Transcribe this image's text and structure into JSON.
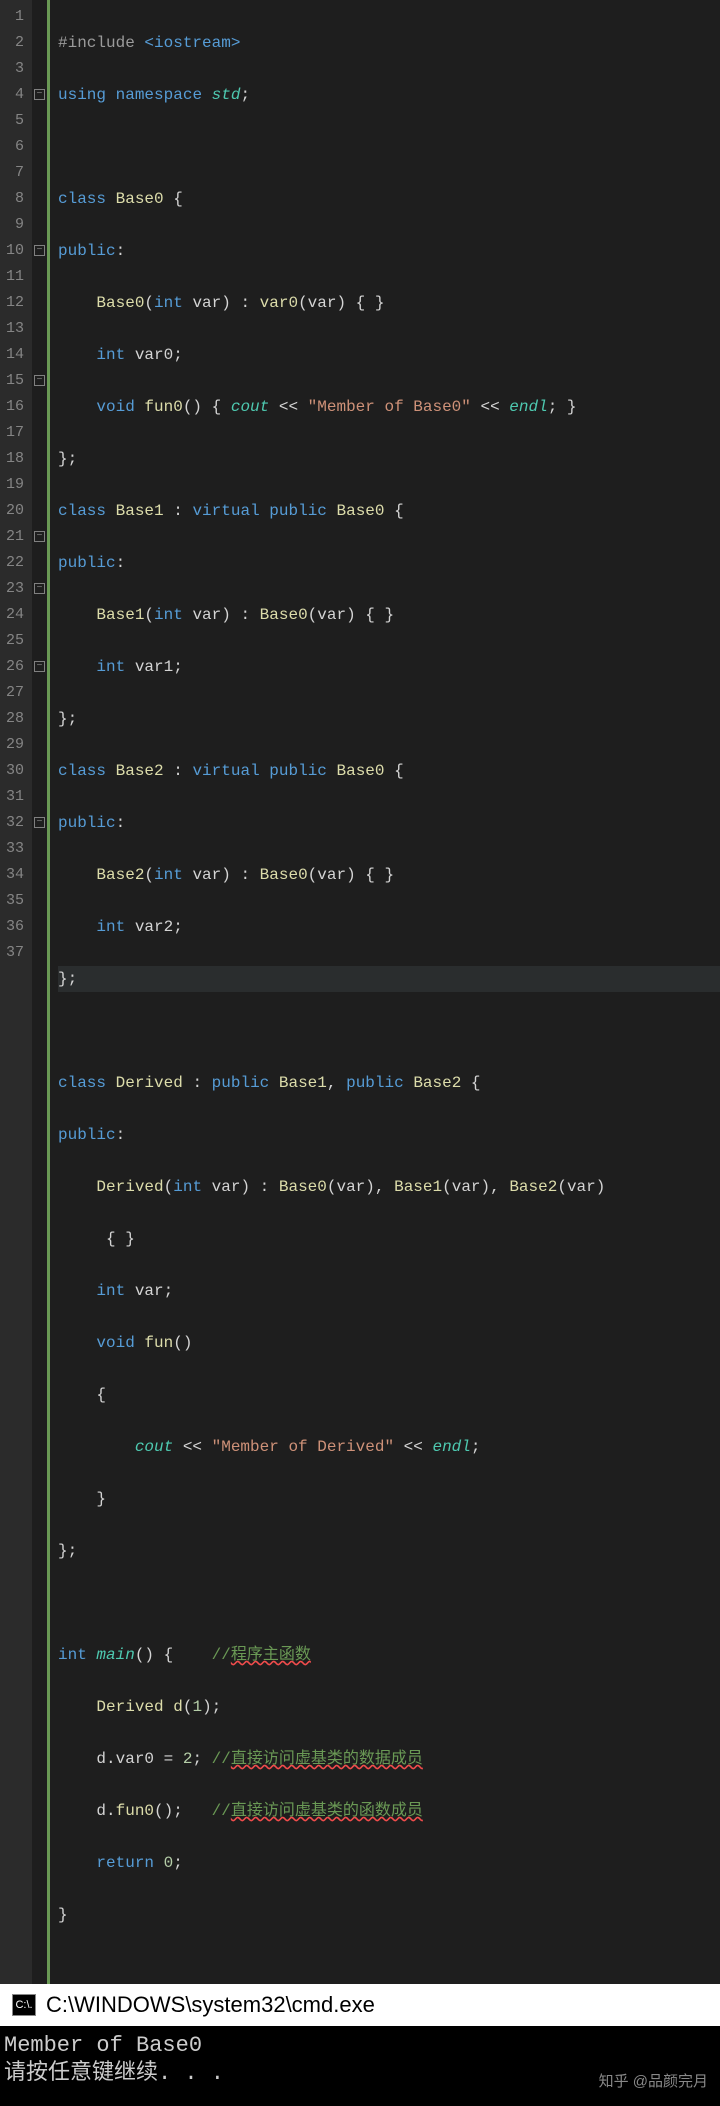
{
  "lines": {
    "count": 37
  },
  "fold_positions": [
    4,
    10,
    15,
    21,
    23,
    26,
    32
  ],
  "code": {
    "l1": {
      "a": "#include",
      "b": "<iostream>"
    },
    "l2": {
      "a": "using",
      "b": "namespace",
      "c": "std",
      "d": ";"
    },
    "l4": {
      "a": "class",
      "b": "Base0",
      "c": " {"
    },
    "l5": {
      "a": "public",
      "b": ":"
    },
    "l6": {
      "a": "Base0",
      "b": "(",
      "c": "int",
      "d": " var) : ",
      "e": "var0",
      "f": "(var) { }"
    },
    "l7": {
      "a": "int",
      "b": " var0;"
    },
    "l8": {
      "a": "void",
      "b": " ",
      "c": "fun0",
      "d": "() { ",
      "e": "cout",
      "f": " << ",
      "g": "\"Member of Base0\"",
      "h": " << ",
      "i": "endl",
      "j": "; }"
    },
    "l9": {
      "a": "};"
    },
    "l10": {
      "a": "class",
      "b": "Base1",
      "c": " : ",
      "d": "virtual",
      "e": " ",
      "f": "public",
      "g": " ",
      "h": "Base0",
      "i": " {"
    },
    "l11": {
      "a": "public",
      "b": ":"
    },
    "l12": {
      "a": "Base1",
      "b": "(",
      "c": "int",
      "d": " var) : ",
      "e": "Base0",
      "f": "(var) { }"
    },
    "l13": {
      "a": "int",
      "b": " var1;"
    },
    "l14": {
      "a": "};"
    },
    "l15": {
      "a": "class",
      "b": "Base2",
      "c": " : ",
      "d": "virtual",
      "e": " ",
      "f": "public",
      "g": " ",
      "h": "Base0",
      "i": " {"
    },
    "l16": {
      "a": "public",
      "b": ":"
    },
    "l17": {
      "a": "Base2",
      "b": "(",
      "c": "int",
      "d": " var) : ",
      "e": "Base0",
      "f": "(var) { }"
    },
    "l18": {
      "a": "int",
      "b": " var2;"
    },
    "l19": {
      "a": "};"
    },
    "l21": {
      "a": "class",
      "b": "Derived",
      "c": " : ",
      "d": "public",
      "e": " ",
      "f": "Base1",
      "g": ", ",
      "h": "public",
      "i": " ",
      "j": "Base2",
      "k": " {"
    },
    "l22": {
      "a": "public",
      "b": ":"
    },
    "l23": {
      "a": "Derived",
      "b": "(",
      "c": "int",
      "d": " var) : ",
      "e": "Base0",
      "f": "(var), ",
      "g": "Base1",
      "h": "(var), ",
      "i": "Base2",
      "j": "(var)"
    },
    "l24": {
      "a": "{ }"
    },
    "l25": {
      "a": "int",
      "b": " var;"
    },
    "l26": {
      "a": "void",
      "b": " ",
      "c": "fun",
      "d": "()"
    },
    "l27": {
      "a": "{"
    },
    "l28": {
      "a": "cout",
      "b": " << ",
      "c": "\"Member of Derived\"",
      "d": " << ",
      "e": "endl",
      "f": ";"
    },
    "l29": {
      "a": "}"
    },
    "l30": {
      "a": "};"
    },
    "l32": {
      "a": "int",
      "b": " ",
      "c": "main",
      "d": "() {    ",
      "e": "//",
      "f": "程序主函数"
    },
    "l33": {
      "a": "Derived",
      "b": " ",
      "c": "d",
      "d": "(",
      "e": "1",
      "f": ");"
    },
    "l34": {
      "a": "d.var0 = ",
      "b": "2",
      "c": "; ",
      "d": "//",
      "e": "直接访问虚基类的数据成员"
    },
    "l35": {
      "a": "d.",
      "b": "fun0",
      "c": "();   ",
      "d": "//",
      "e": "直接访问虚基类的函数成员"
    },
    "l36": {
      "a": "return",
      "b": " ",
      "c": "0",
      "d": ";"
    },
    "l37": {
      "a": "}"
    }
  },
  "titlebar": {
    "icon_text": "C:\\.",
    "path": "C:\\WINDOWS\\system32\\cmd.exe"
  },
  "console": {
    "line1": "Member of Base0",
    "line2": "请按任意键继续. . ."
  },
  "watermark": "知乎 @品颜完月"
}
